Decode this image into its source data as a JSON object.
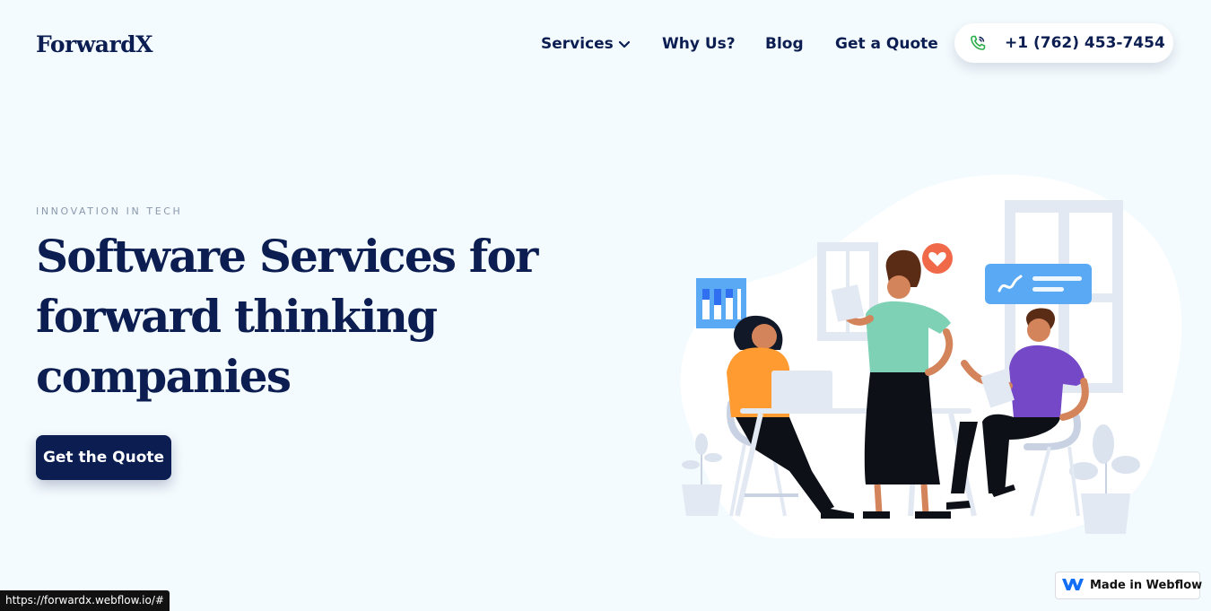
{
  "header": {
    "logo": "ForwardX",
    "nav": [
      {
        "label": "Services",
        "has_dropdown": true
      },
      {
        "label": "Why Us?"
      },
      {
        "label": "Blog"
      },
      {
        "label": "Get a Quote"
      }
    ],
    "phone": {
      "number": "+1 (762) 453-7454",
      "icon": "phone-icon"
    }
  },
  "hero": {
    "eyebrow": "INNOVATION IN TECH",
    "title": "Software Services for forward thinking companies",
    "cta_label": "Get the Quote"
  },
  "status_bar": {
    "url": "https://forwardx.webflow.io/#"
  },
  "badge": {
    "label": "Made in Webflow",
    "icon": "webflow-logo-icon"
  },
  "colors": {
    "brand_navy": "#0b1d51",
    "background": "#f4fbfe",
    "accent_blue": "#5aa9f5",
    "heart_red": "#f06a4a",
    "phone_green": "#2cae4a"
  }
}
